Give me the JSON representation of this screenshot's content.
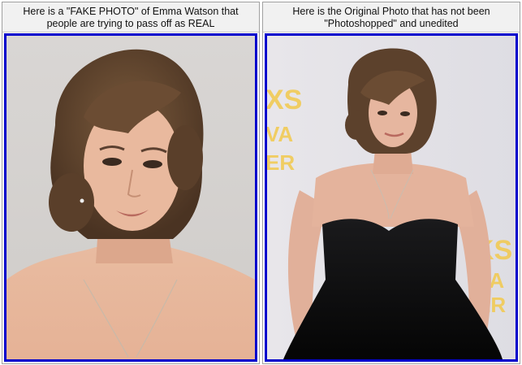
{
  "panels": [
    {
      "caption_line1": "Here is a \"FAKE PHOTO\" of Emma Watson that",
      "caption_line2": "people are trying to pass off as REAL"
    },
    {
      "caption_line1": "Here is the Original Photo that has not been",
      "caption_line2": "\"Photoshopped\" and unedited"
    }
  ],
  "colors": {
    "border": "#0000cc",
    "caption_bg": "#f1f1f1"
  }
}
